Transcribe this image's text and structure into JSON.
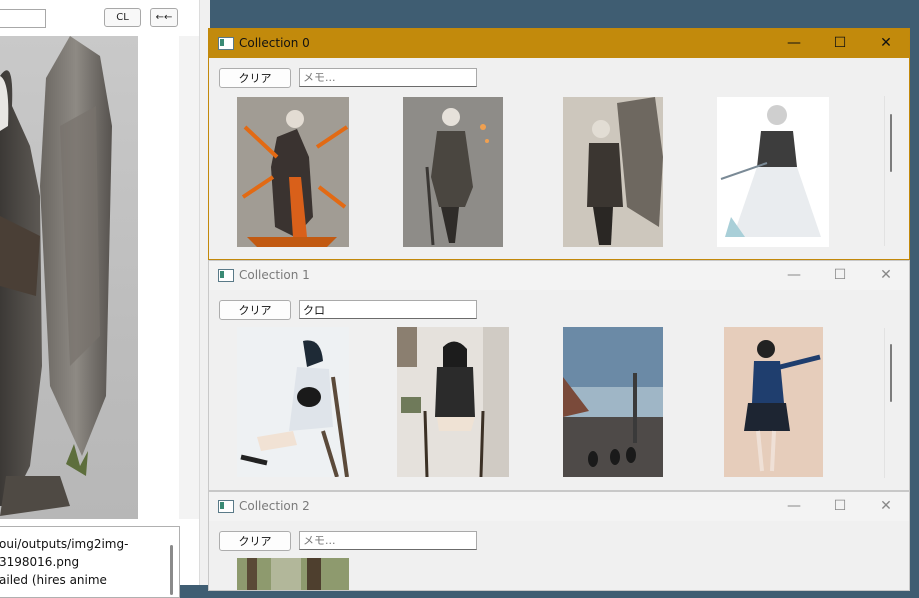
{
  "left_panel": {
    "cl_button": "CL",
    "back_button": "←←",
    "info_text": "oui/outputs/img2img-\n3198016.png\nailed (hires anime"
  },
  "windows": [
    {
      "title": "Collection 0",
      "active": true,
      "clear_label": "クリア",
      "memo_value": "",
      "memo_placeholder": "メモ...",
      "images": [
        "armored girl with orange flames",
        "armored girl walking",
        "knight with large shield",
        "white-dress girl with sword"
      ]
    },
    {
      "title": "Collection 1",
      "active": false,
      "clear_label": "クリア",
      "memo_value": "クロ",
      "memo_placeholder": "メモ...",
      "images": [
        "girl with black cat on chair",
        "girl sitting on chair",
        "street with cats",
        "girl in navy dress stretching"
      ]
    },
    {
      "title": "Collection 2",
      "active": false,
      "clear_label": "クリア",
      "memo_value": "",
      "memo_placeholder": "メモ...",
      "images": [
        "forest scene"
      ]
    }
  ],
  "window_controls": {
    "minimize": "—",
    "maximize": "☐",
    "close": "✕"
  },
  "colors": {
    "desktop": "#3f5d72",
    "active_titlebar": "#c28a0c"
  }
}
